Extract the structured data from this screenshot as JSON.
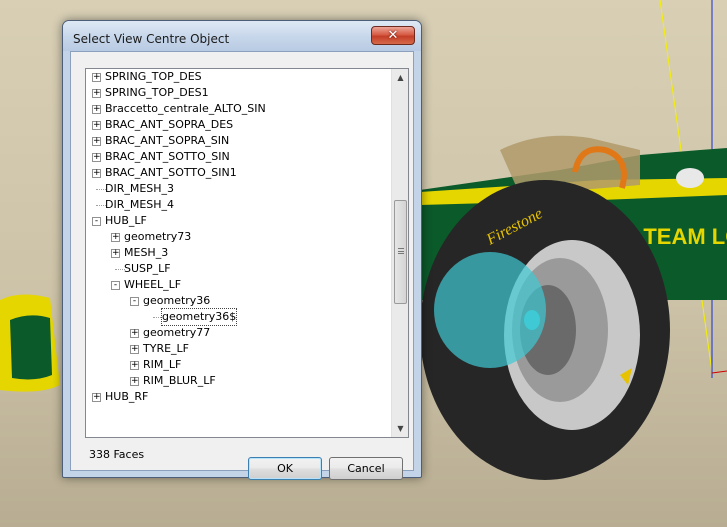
{
  "window": {
    "title": "Select View Centre Object",
    "close_glyph": "✕"
  },
  "tree": {
    "items": [
      {
        "label": "SPRING_TOP_DES",
        "depth": 0,
        "expander": "+"
      },
      {
        "label": "SPRING_TOP_DES1",
        "depth": 0,
        "expander": "+"
      },
      {
        "label": "Braccetto_centrale_ALTO_SIN",
        "depth": 0,
        "expander": "+"
      },
      {
        "label": "BRAC_ANT_SOPRA_DES",
        "depth": 0,
        "expander": "+"
      },
      {
        "label": "BRAC_ANT_SOPRA_SIN",
        "depth": 0,
        "expander": "+"
      },
      {
        "label": "BRAC_ANT_SOTTO_SIN",
        "depth": 0,
        "expander": "+"
      },
      {
        "label": "BRAC_ANT_SOTTO_SIN1",
        "depth": 0,
        "expander": "+"
      },
      {
        "label": "DIR_MESH_3",
        "depth": 0,
        "expander": ""
      },
      {
        "label": "DIR_MESH_4",
        "depth": 0,
        "expander": ""
      },
      {
        "label": "HUB_LF",
        "depth": 0,
        "expander": "-"
      },
      {
        "label": "geometry73",
        "depth": 1,
        "expander": "+"
      },
      {
        "label": "MESH_3",
        "depth": 1,
        "expander": "+"
      },
      {
        "label": "SUSP_LF",
        "depth": 1,
        "expander": ""
      },
      {
        "label": "WHEEL_LF",
        "depth": 1,
        "expander": "-"
      },
      {
        "label": "geometry36",
        "depth": 2,
        "expander": "-"
      },
      {
        "label": "geometry36$",
        "depth": 3,
        "expander": "",
        "selected": true
      },
      {
        "label": "geometry77",
        "depth": 2,
        "expander": "+"
      },
      {
        "label": "TYRE_LF",
        "depth": 2,
        "expander": "+"
      },
      {
        "label": "RIM_LF",
        "depth": 2,
        "expander": "+"
      },
      {
        "label": "RIM_BLUR_LF",
        "depth": 2,
        "expander": "+"
      },
      {
        "label": "HUB_RF",
        "depth": 0,
        "expander": "+"
      }
    ],
    "scroll_up_glyph": "▲",
    "scroll_down_glyph": "▼"
  },
  "footer": {
    "face_count": "338 Faces",
    "ok_label": "OK",
    "cancel_label": "Cancel"
  },
  "viewport": {
    "sponsor_text": "-TEAM LO",
    "tyre_text": "Firestone",
    "colors": {
      "body_green": "#0b5a2a",
      "body_yellow": "#e6d600",
      "tyre": "#262626",
      "highlight": "#3ec9d4"
    }
  }
}
